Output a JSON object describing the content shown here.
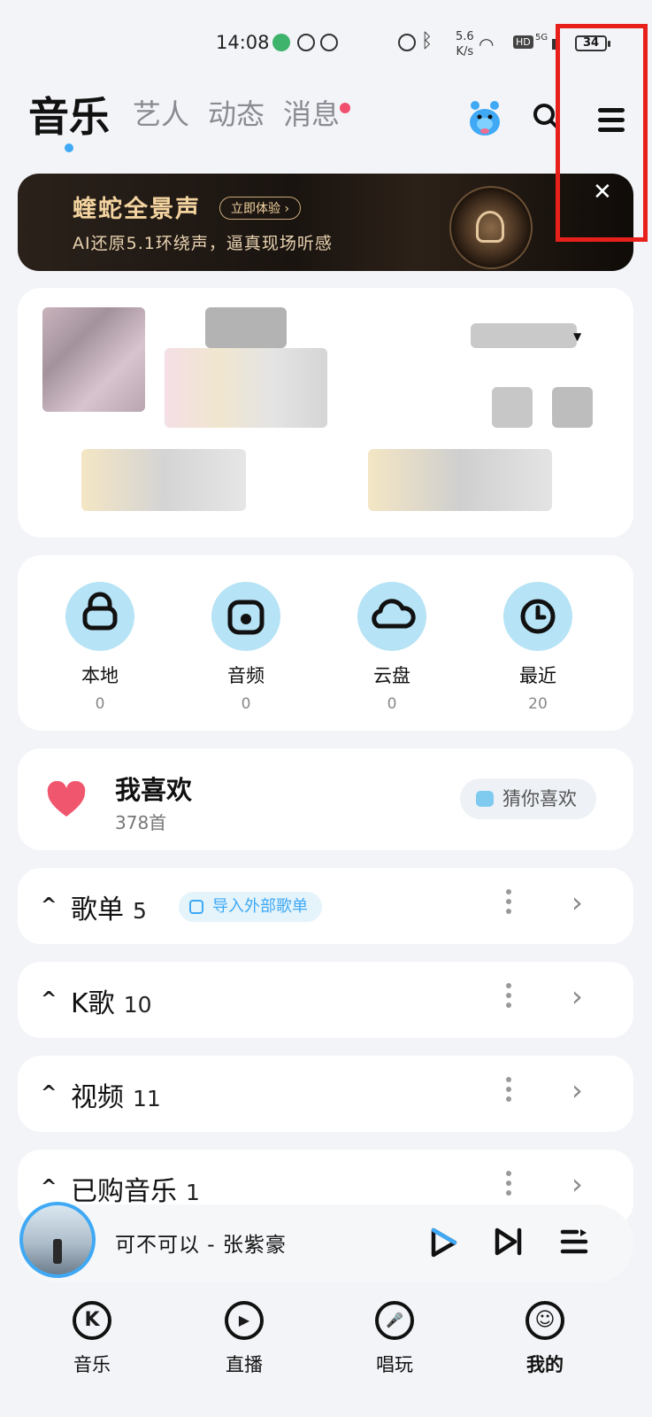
{
  "status_bar": {
    "time": "14:08",
    "net_speed": "5.6",
    "net_unit": "K/s",
    "hd": "HD",
    "network": "5G",
    "battery": "34"
  },
  "header": {
    "tabs": [
      {
        "label": "音乐",
        "active": true
      },
      {
        "label": "艺人"
      },
      {
        "label": "动态"
      },
      {
        "label": "消息"
      }
    ]
  },
  "banner": {
    "title": "蝰蛇全景声",
    "button": "立即体验 ›",
    "subtitle": "AI还原5.1环绕声，逼真现场听感",
    "close": "✕"
  },
  "quick_access": [
    {
      "label": "本地",
      "count": "0",
      "icon": "local-music-icon"
    },
    {
      "label": "音频",
      "count": "0",
      "icon": "audio-icon"
    },
    {
      "label": "云盘",
      "count": "0",
      "icon": "cloud-icon"
    },
    {
      "label": "最近",
      "count": "20",
      "icon": "clock-icon"
    }
  ],
  "favorites": {
    "title": "我喜欢",
    "count": "378首",
    "guess_button": "猜你喜欢"
  },
  "sections": [
    {
      "label": "歌单",
      "count": "5",
      "action": "导入外部歌单"
    },
    {
      "label": "K歌",
      "count": "10"
    },
    {
      "label": "视频",
      "count": "11"
    },
    {
      "label": "已购音乐",
      "count": "1"
    }
  ],
  "player": {
    "song": "可不可以 - 张紫豪"
  },
  "bottom_nav": [
    {
      "label": "音乐",
      "glyph": "K"
    },
    {
      "label": "直播",
      "glyph": "▶"
    },
    {
      "label": "唱玩",
      "glyph": "🎤"
    },
    {
      "label": "我的",
      "glyph": "☺"
    }
  ],
  "colors": {
    "accent": "#3fa9f5",
    "highlight_box": "#e8201c",
    "heart": "#f0566e",
    "icon_bg": "#b6e3f5"
  }
}
